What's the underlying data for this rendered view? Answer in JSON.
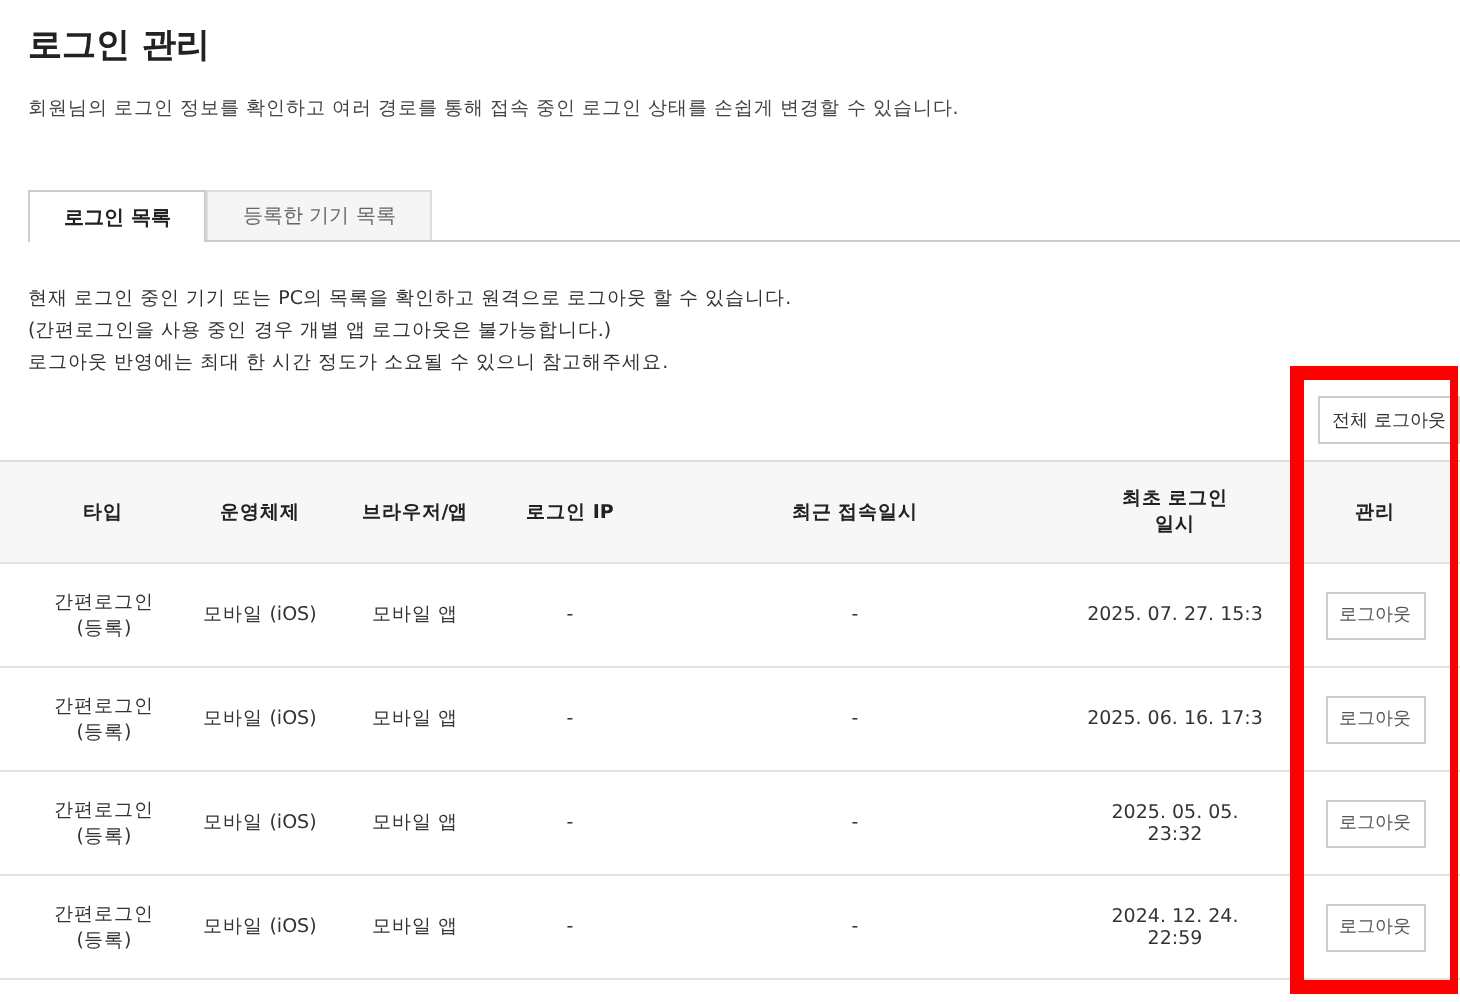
{
  "title": "로그인 관리",
  "subtitle": "회원님의 로그인 정보를 확인하고 여러 경로를 통해 접속 중인 로그인 상태를 손쉽게 변경할 수 있습니다.",
  "tabs": [
    {
      "label": "로그인 목록",
      "selected": true
    },
    {
      "label": "등록한 기기 목록",
      "selected": false
    }
  ],
  "notice": [
    "현재 로그인 중인 기기 또는 PC의 목록을 확인하고 원격으로 로그아웃 할 수 있습니다.",
    "(간편로그인을 사용 중인 경우 개별 앱 로그아웃은 불가능합니다.)",
    "로그아웃 반영에는 최대 한 시간 정도가 소요될 수 있으니 참고해주세요."
  ],
  "logout_all_button": "전체 로그아웃",
  "table": {
    "columns": [
      "타입",
      "운영체제",
      "브라우저/앱",
      "로그인 IP",
      "최근 접속일시",
      "최초 로그인\n일시",
      "관리"
    ],
    "rows": [
      {
        "type": "간편로그인\n(등록)",
        "os": "모바일 (iOS)",
        "browser": "모바일 앱",
        "ip": "-",
        "last_access": "-",
        "first_login": "2025. 07. 27. 15:3",
        "action": "로그아웃"
      },
      {
        "type": "간편로그인\n(등록)",
        "os": "모바일 (iOS)",
        "browser": "모바일 앱",
        "ip": "-",
        "last_access": "-",
        "first_login": "2025. 06. 16. 17:3",
        "action": "로그아웃"
      },
      {
        "type": "간편로그인\n(등록)",
        "os": "모바일 (iOS)",
        "browser": "모바일 앱",
        "ip": "-",
        "last_access": "-",
        "first_login": "2025. 05. 05.\n23:32",
        "action": "로그아웃"
      },
      {
        "type": "간편로그인\n(등록)",
        "os": "모바일 (iOS)",
        "browser": "모바일 앱",
        "ip": "-",
        "last_access": "-",
        "first_login": "2024. 12. 24.\n22:59",
        "action": "로그아웃"
      }
    ]
  },
  "highlight": {
    "color": "#ff0000"
  }
}
